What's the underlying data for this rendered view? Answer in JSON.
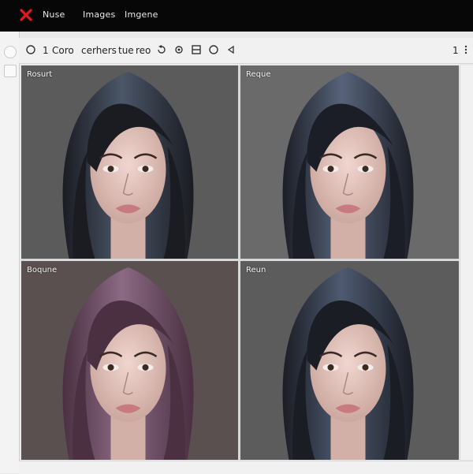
{
  "menubar": {
    "items": [
      "Nuse",
      "Images",
      "Imgene"
    ]
  },
  "toolbar": {
    "text_items": [
      "C",
      "1",
      "Coro",
      "cerhers",
      "tue",
      "reo"
    ],
    "right_number": "1",
    "icons": [
      "circle-icon",
      "back-icon",
      "gear-icon",
      "panel-icon",
      "circle-outline-icon",
      "triangle-left-icon",
      "more-icon"
    ]
  },
  "panels": [
    {
      "label": "Rosurt",
      "hair": "#1a1c22",
      "hair_highlight": "#4b5668",
      "bg": "#5b5b5b"
    },
    {
      "label": "Reque",
      "hair": "#1b1e26",
      "hair_highlight": "#57637a",
      "bg": "#6a6a6a"
    },
    {
      "label": "Boqune",
      "hair": "#4a3041",
      "hair_highlight": "#8b6a84",
      "bg": "#5a5050"
    },
    {
      "label": "Reun",
      "hair": "#1a1d24",
      "hair_highlight": "#4e5a70",
      "bg": "#5c5c5c"
    }
  ],
  "colors": {
    "close_x": "#e01b1b",
    "topbar": "#070707"
  }
}
